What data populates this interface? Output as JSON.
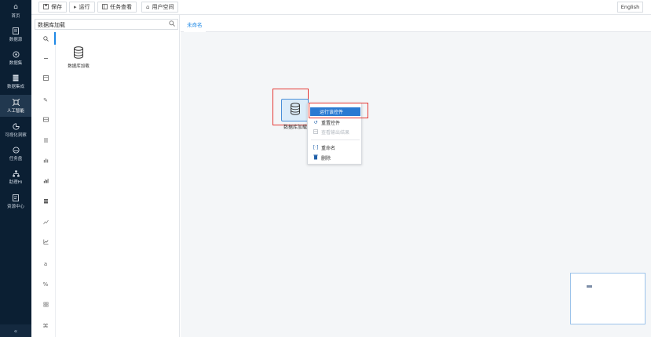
{
  "toolbar": {
    "save_label": "保存",
    "run_label": "运行",
    "tasks_label": "任务查看",
    "user_space_label": "用户空间",
    "language_label": "English"
  },
  "nav": {
    "items": [
      {
        "label": "首页",
        "icon": "home-icon"
      },
      {
        "label": "数据源",
        "icon": "file-icon"
      },
      {
        "label": "数据集",
        "icon": "dataset-icon"
      },
      {
        "label": "数据集成",
        "icon": "stack-icon"
      },
      {
        "label": "人工智能",
        "icon": "ai-icon",
        "active": true
      },
      {
        "label": "可视化洞察",
        "icon": "chart-icon"
      },
      {
        "label": "任务盘",
        "icon": "task-icon"
      },
      {
        "label": "助理Hi",
        "icon": "org-icon"
      },
      {
        "label": "资源中心",
        "icon": "resource-icon"
      }
    ],
    "collapse_label": "«"
  },
  "panel": {
    "search_value": "数据库加载",
    "component_label": "数据库加载"
  },
  "canvas": {
    "tab_label": "未命名",
    "node_label": "数据库加载"
  },
  "context_menu": {
    "items": [
      {
        "label": "运行该控件",
        "state": "highlighted"
      },
      {
        "label": "重置控件",
        "state": "normal"
      },
      {
        "label": "查看输出结果",
        "state": "disabled"
      },
      {
        "label": "重命名",
        "state": "normal"
      },
      {
        "label": "删除",
        "state": "normal"
      }
    ]
  },
  "colors": {
    "nav_bg": "#0b1f33",
    "accent": "#1e88e5",
    "highlight_box": "#e53935",
    "menu_primary": "#2a7ad2"
  }
}
